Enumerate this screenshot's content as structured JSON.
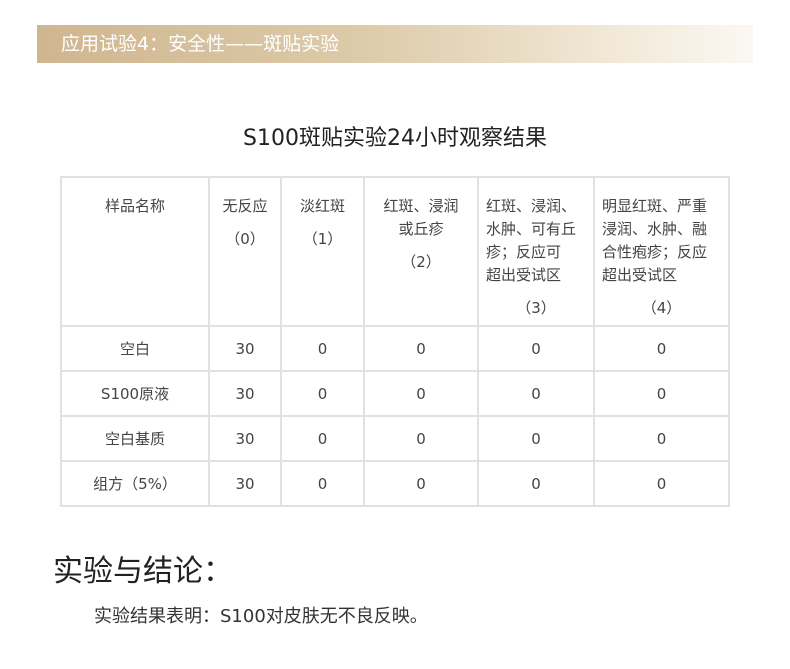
{
  "banner": {
    "title": "应用试验4：安全性——斑贴实验"
  },
  "table": {
    "title": "S100斑贴实验24小时观察结果",
    "headers": [
      {
        "lines": [
          "样品名称"
        ],
        "code": ""
      },
      {
        "lines": [
          "无反应"
        ],
        "code": "（0）"
      },
      {
        "lines": [
          "淡红斑"
        ],
        "code": "（1）"
      },
      {
        "lines": [
          "红斑、浸润",
          "或丘疹"
        ],
        "code": "（2）"
      },
      {
        "lines": [
          "红斑、浸润、",
          "水肿、可有丘",
          "疹；反应可",
          "超出受试区"
        ],
        "code": "（3）"
      },
      {
        "lines": [
          "明显红斑、严重",
          "浸润、水肿、融",
          "合性疱疹；反应",
          "超出受试区"
        ],
        "code": "（4）"
      }
    ],
    "rows": [
      {
        "name": "空白",
        "values": [
          "30",
          "0",
          "0",
          "0",
          "0"
        ]
      },
      {
        "name": "S100原液",
        "values": [
          "30",
          "0",
          "0",
          "0",
          "0"
        ]
      },
      {
        "name": "空白基质",
        "values": [
          "30",
          "0",
          "0",
          "0",
          "0"
        ]
      },
      {
        "name": "组方（5%）",
        "values": [
          "30",
          "0",
          "0",
          "0",
          "0"
        ]
      }
    ]
  },
  "conclusion": {
    "title": "实验与结论：",
    "text": "实验结果表明：S100对皮肤无不良反映。"
  }
}
